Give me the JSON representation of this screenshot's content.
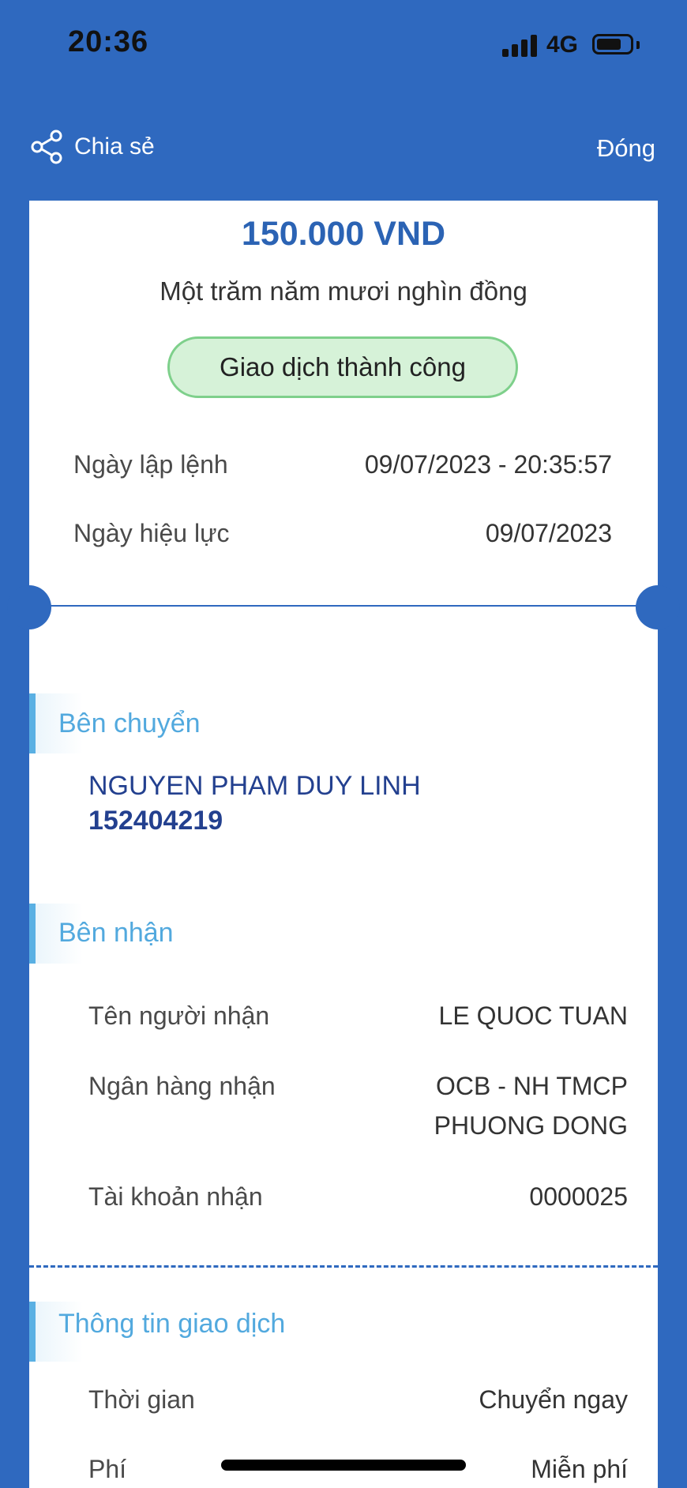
{
  "status_bar": {
    "time": "20:36",
    "network": "4G",
    "battery_level": 0.75
  },
  "header": {
    "share_label": "Chia sẻ",
    "close_label": "Đóng"
  },
  "receipt": {
    "amount": "150.000 VND",
    "amount_in_words": "Một trăm năm mươi nghìn đồng",
    "status": "Giao dịch thành công",
    "order_date_label": "Ngày lập lệnh",
    "order_date_value": "09/07/2023 - 20:35:57",
    "effective_date_label": "Ngày hiệu lực",
    "effective_date_value": "09/07/2023"
  },
  "sender": {
    "section_title": "Bên chuyển",
    "name": "NGUYEN PHAM DUY LINH",
    "account": "152404219"
  },
  "recipient": {
    "section_title": "Bên nhận",
    "name_label": "Tên người nhận",
    "name_value": "LE QUOC TUAN",
    "bank_label": "Ngân hàng nhận",
    "bank_value_line1": "OCB - NH TMCP",
    "bank_value_line2": "PHUONG DONG",
    "account_label": "Tài khoản nhận",
    "account_value": "0000025"
  },
  "transaction_info": {
    "section_title": "Thông tin giao dịch",
    "time_label": "Thời gian",
    "time_value": "Chuyển ngay",
    "fee_label": "Phí",
    "fee_value": "Miễn phí"
  },
  "colors": {
    "primary_blue": "#2f69bf",
    "amount_blue": "#2b63b4",
    "section_accent": "#52a9de",
    "success_bg": "#d6f2d8",
    "success_border": "#7ed08b"
  }
}
